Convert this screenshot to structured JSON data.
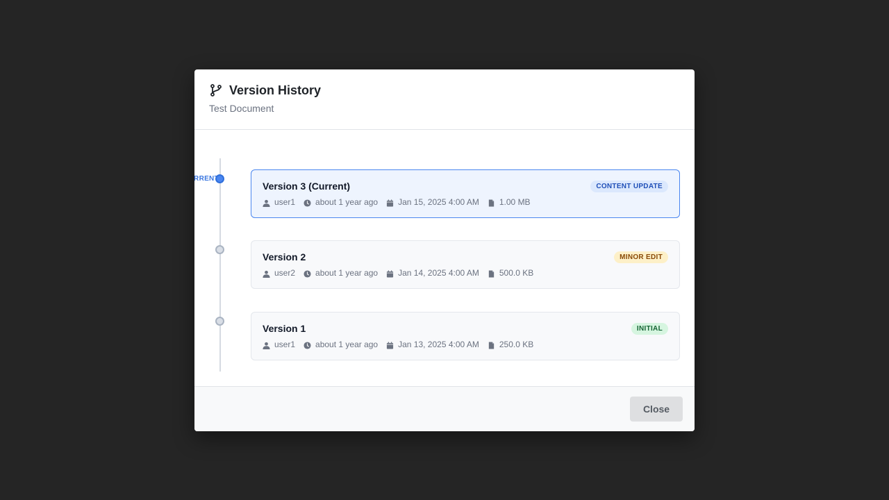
{
  "dialog": {
    "title": "Version History",
    "subtitle": "Test Document",
    "current_label": "CURRENT",
    "close_label": "Close"
  },
  "colors": {
    "accent": "#4a86f0",
    "overlay": "#252525"
  },
  "versions": [
    {
      "title": "Version 3 (Current)",
      "badge": "CONTENT UPDATE",
      "badge_color": "blue",
      "user": "user1",
      "relative_time": "about 1 year ago",
      "date": "Jan 15, 2025 4:00 AM",
      "size": "1.00 MB",
      "current": true
    },
    {
      "title": "Version 2",
      "badge": "MINOR EDIT",
      "badge_color": "amber",
      "user": "user2",
      "relative_time": "about 1 year ago",
      "date": "Jan 14, 2025 4:00 AM",
      "size": "500.0 KB",
      "current": false
    },
    {
      "title": "Version 1",
      "badge": "INITIAL",
      "badge_color": "green",
      "user": "user1",
      "relative_time": "about 1 year ago",
      "date": "Jan 13, 2025 4:00 AM",
      "size": "250.0 KB",
      "current": false
    }
  ]
}
